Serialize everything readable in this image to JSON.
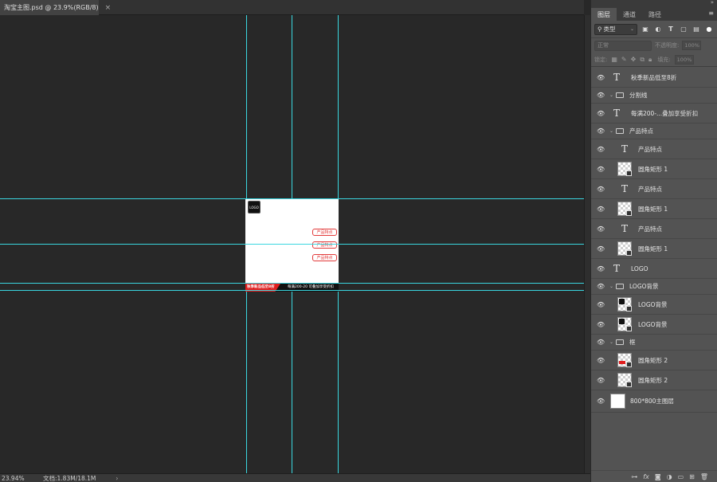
{
  "document": {
    "tab_title": "淘宝主图.psd @ 23.9%(RGB/8)",
    "logo_text": "LOGO",
    "feature_tags": [
      "产品特点",
      "产品特点",
      "产品特点"
    ],
    "banner_left": "秋季新品低至8折",
    "banner_right": "每满200-20 可叠加享受折扣"
  },
  "status": {
    "zoom": "23.94%",
    "doc_info": "文档:1.83M/18.1M",
    "arrow": "›"
  },
  "panel": {
    "tabs": [
      "图层",
      "通道",
      "路径"
    ],
    "filter_kind": "类型",
    "blend_mode": "正常",
    "opacity_label": "不透明度:",
    "opacity_value": "100%",
    "lock_label": "锁定:",
    "fill_label": "填充:",
    "fill_value": "100%"
  },
  "layers": [
    {
      "name": "秋季新品低至8折",
      "kind": "text",
      "indent": 0
    },
    {
      "name": "分割线",
      "kind": "group",
      "indent": 0
    },
    {
      "name": "每满200-...叠加享受折扣",
      "kind": "text",
      "indent": 0
    },
    {
      "name": "产品特点",
      "kind": "group",
      "indent": 0
    },
    {
      "name": "产品特点",
      "kind": "text",
      "indent": 1
    },
    {
      "name": "圆角矩形 1",
      "kind": "shape",
      "indent": 1
    },
    {
      "name": "产品特点",
      "kind": "text",
      "indent": 1
    },
    {
      "name": "圆角矩形 1",
      "kind": "shape",
      "indent": 1
    },
    {
      "name": "产品特点",
      "kind": "text",
      "indent": 1
    },
    {
      "name": "圆角矩形 1",
      "kind": "shape",
      "indent": 1
    },
    {
      "name": "LOGO",
      "kind": "text",
      "indent": 0
    },
    {
      "name": "LOGO背景",
      "kind": "group",
      "indent": 0
    },
    {
      "name": "LOGO背景",
      "kind": "shape-dark",
      "indent": 1
    },
    {
      "name": "LOGO背景",
      "kind": "shape-dark",
      "indent": 1
    },
    {
      "name": "框",
      "kind": "group",
      "indent": 0
    },
    {
      "name": "圆角矩形 2",
      "kind": "shape-red",
      "indent": 1
    },
    {
      "name": "圆角矩形 2",
      "kind": "shape",
      "indent": 1
    },
    {
      "name": "800*800主图层",
      "kind": "background",
      "indent": 0
    }
  ],
  "icons": {
    "eye": "eye-icon",
    "folder": "folder-icon",
    "text_layer": "text-layer-icon"
  },
  "colors": {
    "guide": "#3ad7e0",
    "accent_red": "#e01e1e",
    "panel_bg": "#535353",
    "canvas_bg": "#282828"
  }
}
